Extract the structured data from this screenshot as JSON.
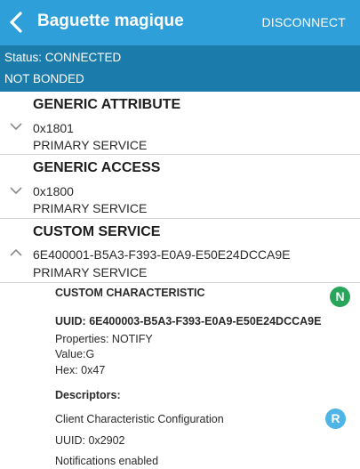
{
  "header": {
    "title": "Baguette magique",
    "disconnect_label": "DISCONNECT"
  },
  "status": {
    "connection": "Status: CONNECTED",
    "bond": "NOT BONDED"
  },
  "services": [
    {
      "name": "GENERIC ATTRIBUTE",
      "uuid": "0x1801",
      "type": "PRIMARY SERVICE",
      "expanded": false
    },
    {
      "name": "GENERIC ACCESS",
      "uuid": "0x1800",
      "type": "PRIMARY SERVICE",
      "expanded": false
    },
    {
      "name": "CUSTOM SERVICE",
      "uuid": "6E400001-B5A3-F393-E0A9-E50E24DCCA9E",
      "type": "PRIMARY SERVICE",
      "expanded": true
    }
  ],
  "characteristic": {
    "name": "CUSTOM CHARACTERISTIC",
    "uuid": "UUID: 6E400003-B5A3-F393-E0A9-E50E24DCCA9E",
    "properties": "Properties: NOTIFY",
    "value": "Value:G",
    "hex": "Hex: 0x47",
    "notify_badge": "N",
    "descriptors_label": "Descriptors:",
    "descriptor": {
      "name": "Client Characteristic Configuration",
      "uuid": "UUID: 0x2902",
      "state": "Notifications enabled",
      "read_badge": "R"
    }
  },
  "colors": {
    "appbar": "#2e9fd9",
    "statusbar": "#1b7bab",
    "notify_badge": "#27a55a",
    "read_badge": "#4fb4e6"
  },
  "icons": {
    "back": "back-arrow-icon",
    "collapsed": "chevron-down-icon",
    "expanded": "chevron-up-icon"
  }
}
